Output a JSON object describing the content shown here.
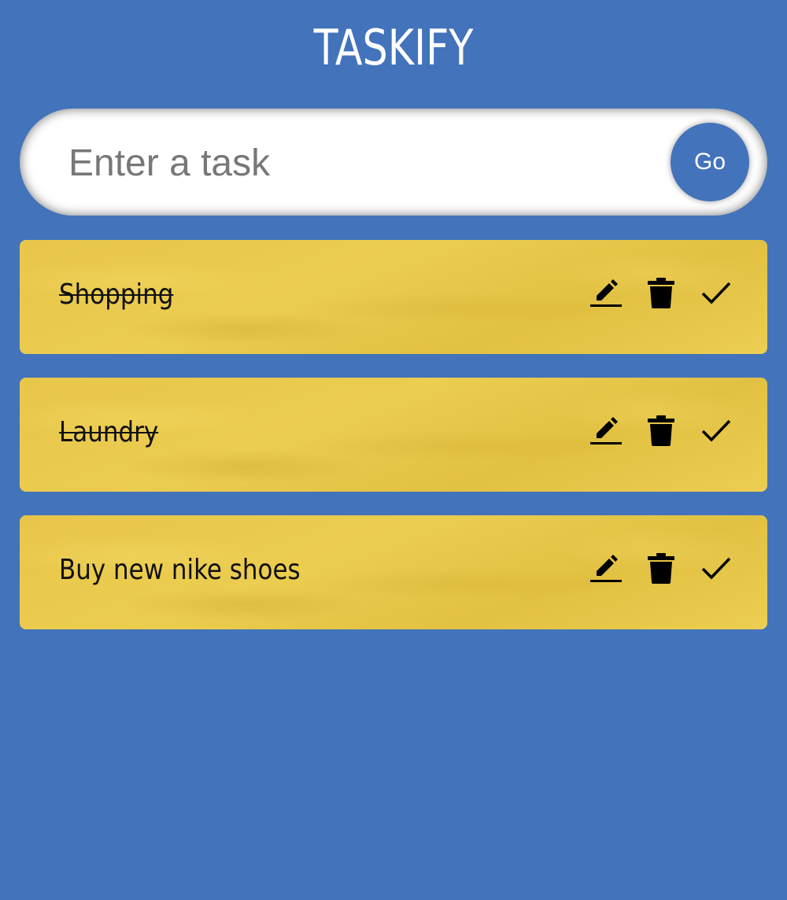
{
  "app": {
    "title": "TASKIFY"
  },
  "form": {
    "input_placeholder": "Enter a task",
    "input_value": "",
    "go_label": "Go"
  },
  "colors": {
    "background": "#4273bb",
    "card": "#e8c64a",
    "button": "#4273bb"
  },
  "tasks": [
    {
      "text": "Shopping",
      "done": true,
      "icons": [
        "edit-icon",
        "delete-icon",
        "check-icon"
      ]
    },
    {
      "text": "Laundry",
      "done": true,
      "icons": [
        "edit-icon",
        "delete-icon",
        "check-icon"
      ]
    },
    {
      "text": "Buy new nike shoes",
      "done": false,
      "icons": [
        "edit-icon",
        "delete-icon",
        "check-icon"
      ]
    }
  ]
}
